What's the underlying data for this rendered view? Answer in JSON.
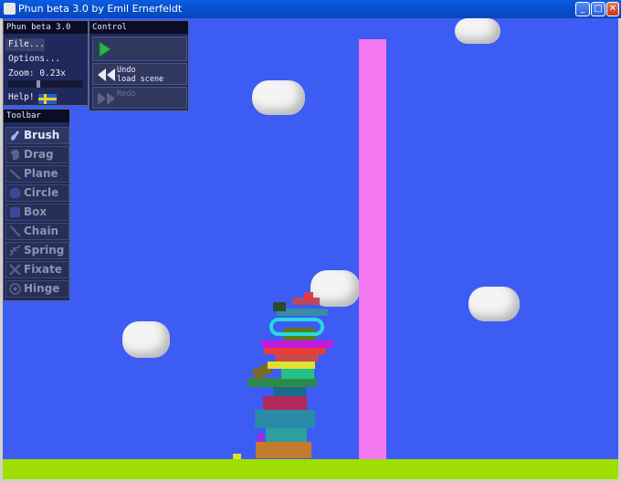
{
  "window": {
    "title": "Phun beta 3.0 by Emil Ernerfeldt",
    "buttons": [
      "minimize",
      "maximize",
      "close"
    ]
  },
  "main_panel": {
    "title": "Phun beta 3.0",
    "file_label": "File...",
    "options_label": "Options...",
    "zoom_label": "Zoom: 0.23x",
    "help_label": "Help!"
  },
  "control_panel": {
    "title": "Control",
    "play_icon": "play-icon",
    "undo_label": "Undo",
    "undo_detail": "load scene",
    "redo_label": "Redo"
  },
  "toolbar": {
    "title": "Toolbar",
    "tools": [
      {
        "label": "Brush",
        "icon": "brush-icon",
        "active": true
      },
      {
        "label": "Drag",
        "icon": "drag-icon",
        "active": false
      },
      {
        "label": "Plane",
        "icon": "plane-icon",
        "active": false
      },
      {
        "label": "Circle",
        "icon": "circle-icon",
        "active": false
      },
      {
        "label": "Box",
        "icon": "box-icon",
        "active": false
      },
      {
        "label": "Chain",
        "icon": "chain-icon",
        "active": false
      },
      {
        "label": "Spring",
        "icon": "spring-icon",
        "active": false
      },
      {
        "label": "Fixate",
        "icon": "fixate-icon",
        "active": false
      },
      {
        "label": "Hinge",
        "icon": "hinge-icon",
        "active": false
      }
    ]
  },
  "scene": {
    "sky_color": "#3c5cf4",
    "ground_color": "#9ede00",
    "pillar_color": "#f277f0"
  }
}
